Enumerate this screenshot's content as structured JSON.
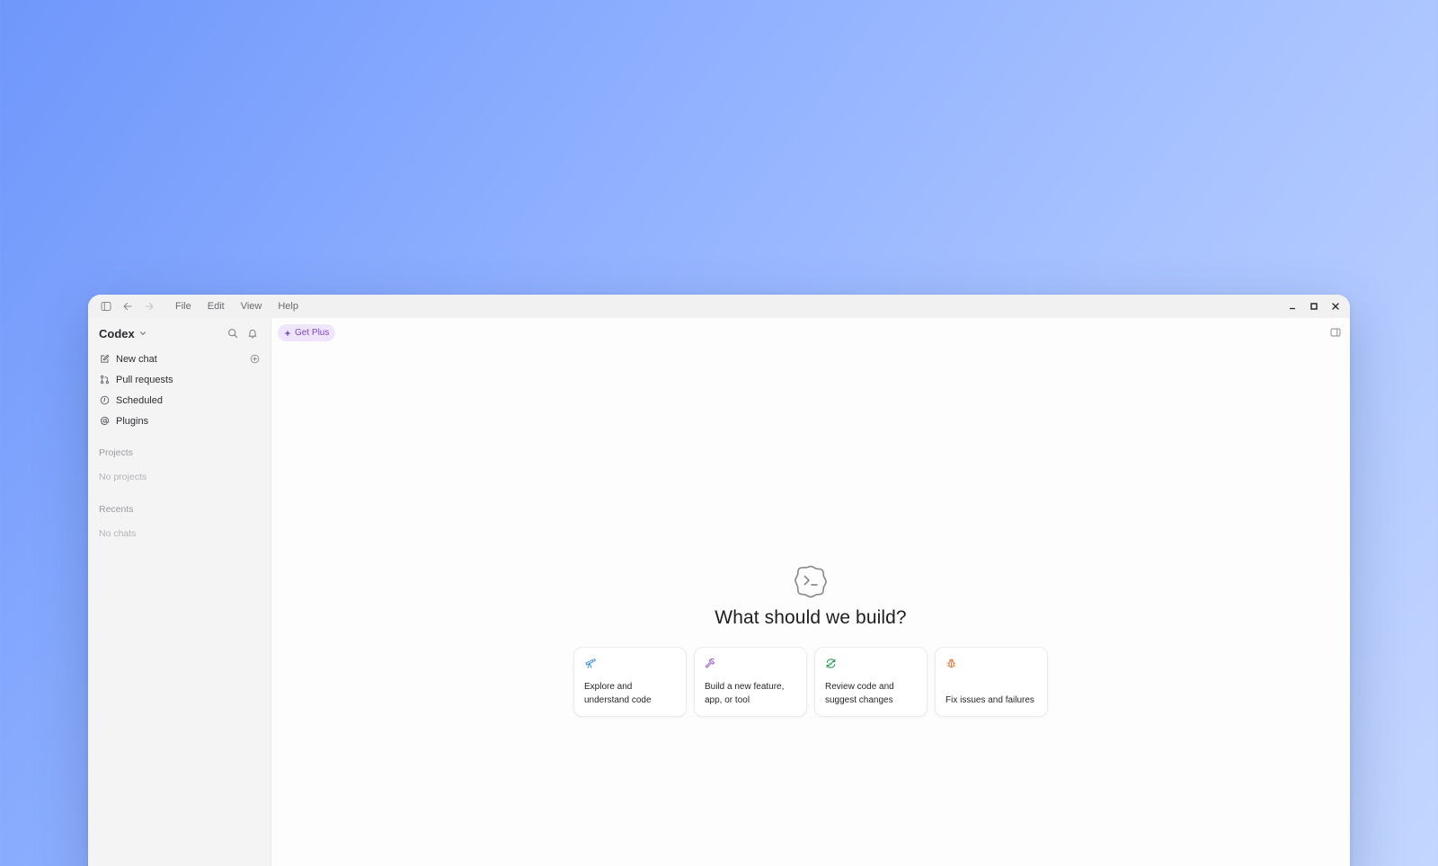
{
  "titlebar": {
    "menu": [
      "File",
      "Edit",
      "View",
      "Help"
    ]
  },
  "sidebar": {
    "brand": "Codex",
    "nav": [
      {
        "label": "New chat",
        "icon": "edit-icon"
      },
      {
        "label": "Pull requests",
        "icon": "git-pull-request-icon"
      },
      {
        "label": "Scheduled",
        "icon": "clock-icon"
      },
      {
        "label": "Plugins",
        "icon": "at-sign-icon"
      }
    ],
    "projects_label": "Projects",
    "projects_empty": "No projects",
    "recents_label": "Recents",
    "recents_empty": "No chats"
  },
  "main": {
    "get_plus_label": "Get Plus",
    "hero_title": "What should we build?",
    "cards": [
      {
        "label": "Explore and understand code",
        "icon": "telescope-icon",
        "color": "#3b8fe0"
      },
      {
        "label": "Build a new feature, app, or tool",
        "icon": "hammer-icon",
        "color": "#9b5bd6"
      },
      {
        "label": "Review code and suggest changes",
        "icon": "refresh-check-icon",
        "color": "#2f9b5a"
      },
      {
        "label": "Fix issues and failures",
        "icon": "bug-icon",
        "color": "#e0702e"
      }
    ]
  }
}
